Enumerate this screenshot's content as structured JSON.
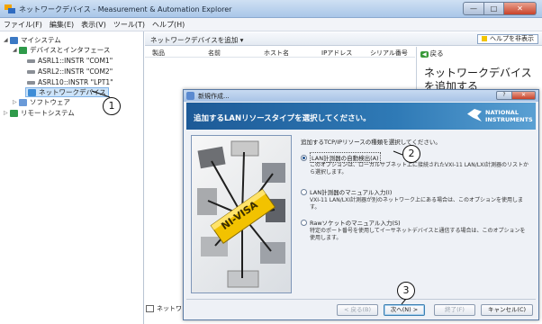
{
  "window": {
    "title": "ネットワークデバイス - Measurement & Automation Explorer",
    "min": "—",
    "max": "□",
    "close": "✕"
  },
  "menu": [
    "ファイル(F)",
    "編集(E)",
    "表示(V)",
    "ツール(T)",
    "ヘルプ(H)"
  ],
  "tree": {
    "my_system": "マイシステム",
    "devices": "デバイスとインタフェース",
    "asrl1": "ASRL1::INSTR \"COM1\"",
    "asrl2": "ASRL2::INSTR \"COM2\"",
    "asrl10": "ASRL10::INSTR \"LPT1\"",
    "network_devices": "ネットワークデバイス",
    "software": "ソフトウェア",
    "remote": "リモートシステム"
  },
  "toolbar": {
    "add_network_device": "ネットワークデバイスを追加 ▾",
    "hide_help": "ヘルプを非表示"
  },
  "columns": [
    "製品",
    "名前",
    "ホスト名",
    "IPアドレス",
    "シリアル番号"
  ],
  "help": {
    "back": "戻る",
    "title": "ネットワークデバイスを追加する"
  },
  "bottom_tab": "ネットワ",
  "dialog": {
    "title": "新規作成...",
    "help_btn": "?",
    "close_btn": "✕",
    "header": "追加するLANリソースタイプを選択してください。",
    "logo_line1": "NATIONAL",
    "logo_line2": "INSTRUMENTS",
    "illustration_text": "NI-VISA",
    "prompt": "追加するTCP/IPリソースの種類を選択してください。",
    "options": [
      {
        "label": "LAN計測器の自動検出(A)",
        "desc": "このオプションは、ローカルサブネット上に接続されたVXI-11 LAN/LXI計測器のリストから選択します。",
        "selected": true
      },
      {
        "label": "LAN計測器のマニュアル入力(I)",
        "desc": "VXI-11 LAN/LXI計測器が別のネットワーク上にある場合は、このオプションを使用します。",
        "selected": false
      },
      {
        "label": "Rawソケットのマニュアル入力(S)",
        "desc": "特定のポート番号を使用してイーサネットデバイスと通信する場合は、このオプションを使用します。",
        "selected": false
      }
    ],
    "buttons": {
      "back": "< 戻る(B)",
      "next": "次へ(N) >",
      "finish": "終了(F)",
      "cancel": "キャンセル(C)"
    }
  },
  "callouts": [
    "1",
    "2",
    "3"
  ]
}
